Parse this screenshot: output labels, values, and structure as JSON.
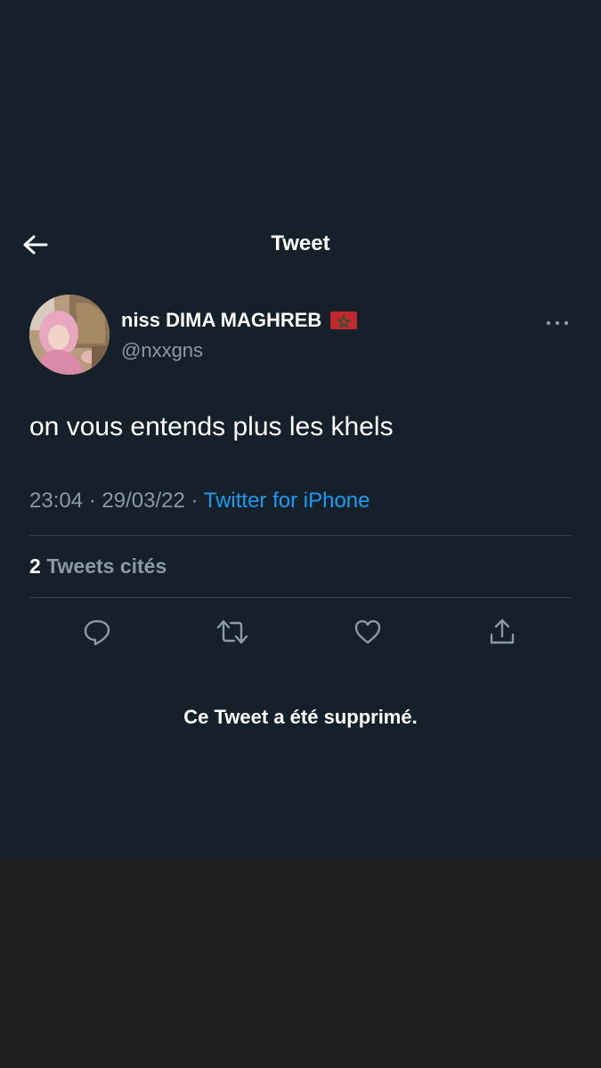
{
  "header": {
    "title": "Tweet"
  },
  "author": {
    "display_name": "niss DIMA MAGHREB",
    "handle": "@nxxgns"
  },
  "tweet": {
    "text": "on vous entends plus les khels",
    "time": "23:04",
    "date": "29/03/22",
    "separator": "·",
    "source": "Twitter for iPhone"
  },
  "quotes": {
    "count": "2",
    "label": "Tweets cités"
  },
  "quoted_tweet": {
    "deleted_message": "Ce Tweet a été supprimé."
  },
  "icons": {
    "back": "arrow-left-icon",
    "more": "ellipsis-icon",
    "reply": "reply-icon",
    "retweet": "retweet-icon",
    "like": "heart-icon",
    "share": "share-icon",
    "flag": "morocco-flag-icon"
  },
  "colors": {
    "background": "#15202b",
    "accent": "#1d9bf0",
    "secondary_text": "#8b98a5",
    "divider": "#38444d"
  }
}
